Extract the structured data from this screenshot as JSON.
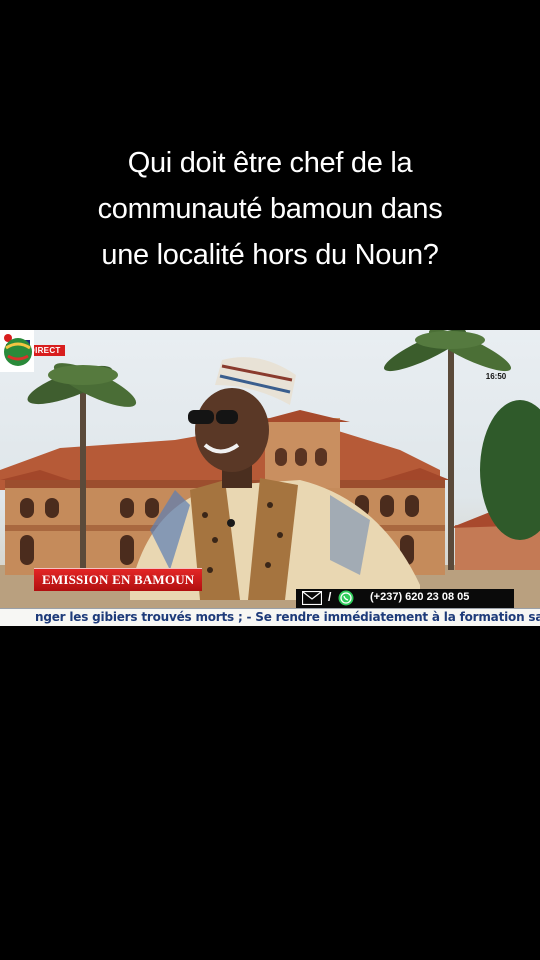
{
  "caption": {
    "line1": "Qui doit être chef de la",
    "line2": "communauté bamoun dans",
    "line3": "une localité hors du Noun?"
  },
  "video": {
    "live_label": "DIRECT",
    "clock": "16:50",
    "logo_icon": "infotv-logo",
    "show_title": "EMISSION EN BAMOUN",
    "contact_separator": "/",
    "contact_phone": "(+237) 620 23 08 05",
    "ticker_text": "nger les gibiers trouvés morts ; - Se rendre immédiatement à la formation sanitaire"
  },
  "colors": {
    "background": "#000000",
    "caption_text": "#ffffff",
    "banner_red": "#d81e1e",
    "ticker_text": "#1e3b7a"
  }
}
